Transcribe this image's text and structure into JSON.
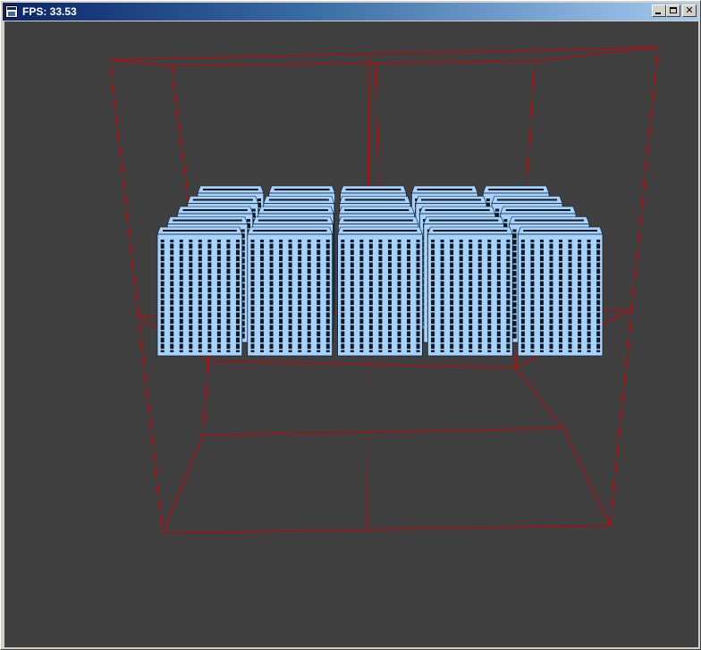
{
  "window": {
    "title": "FPS: 33.53",
    "buttons": {
      "minimize": "minimize",
      "maximize": "maximize",
      "close": "close"
    }
  },
  "scene": {
    "background_color": "#404040",
    "bounding_box_color": "#cc0000",
    "building_color": "#a6d2ff",
    "window_color": "#101820",
    "building_rows": 5,
    "building_columns": 5
  }
}
